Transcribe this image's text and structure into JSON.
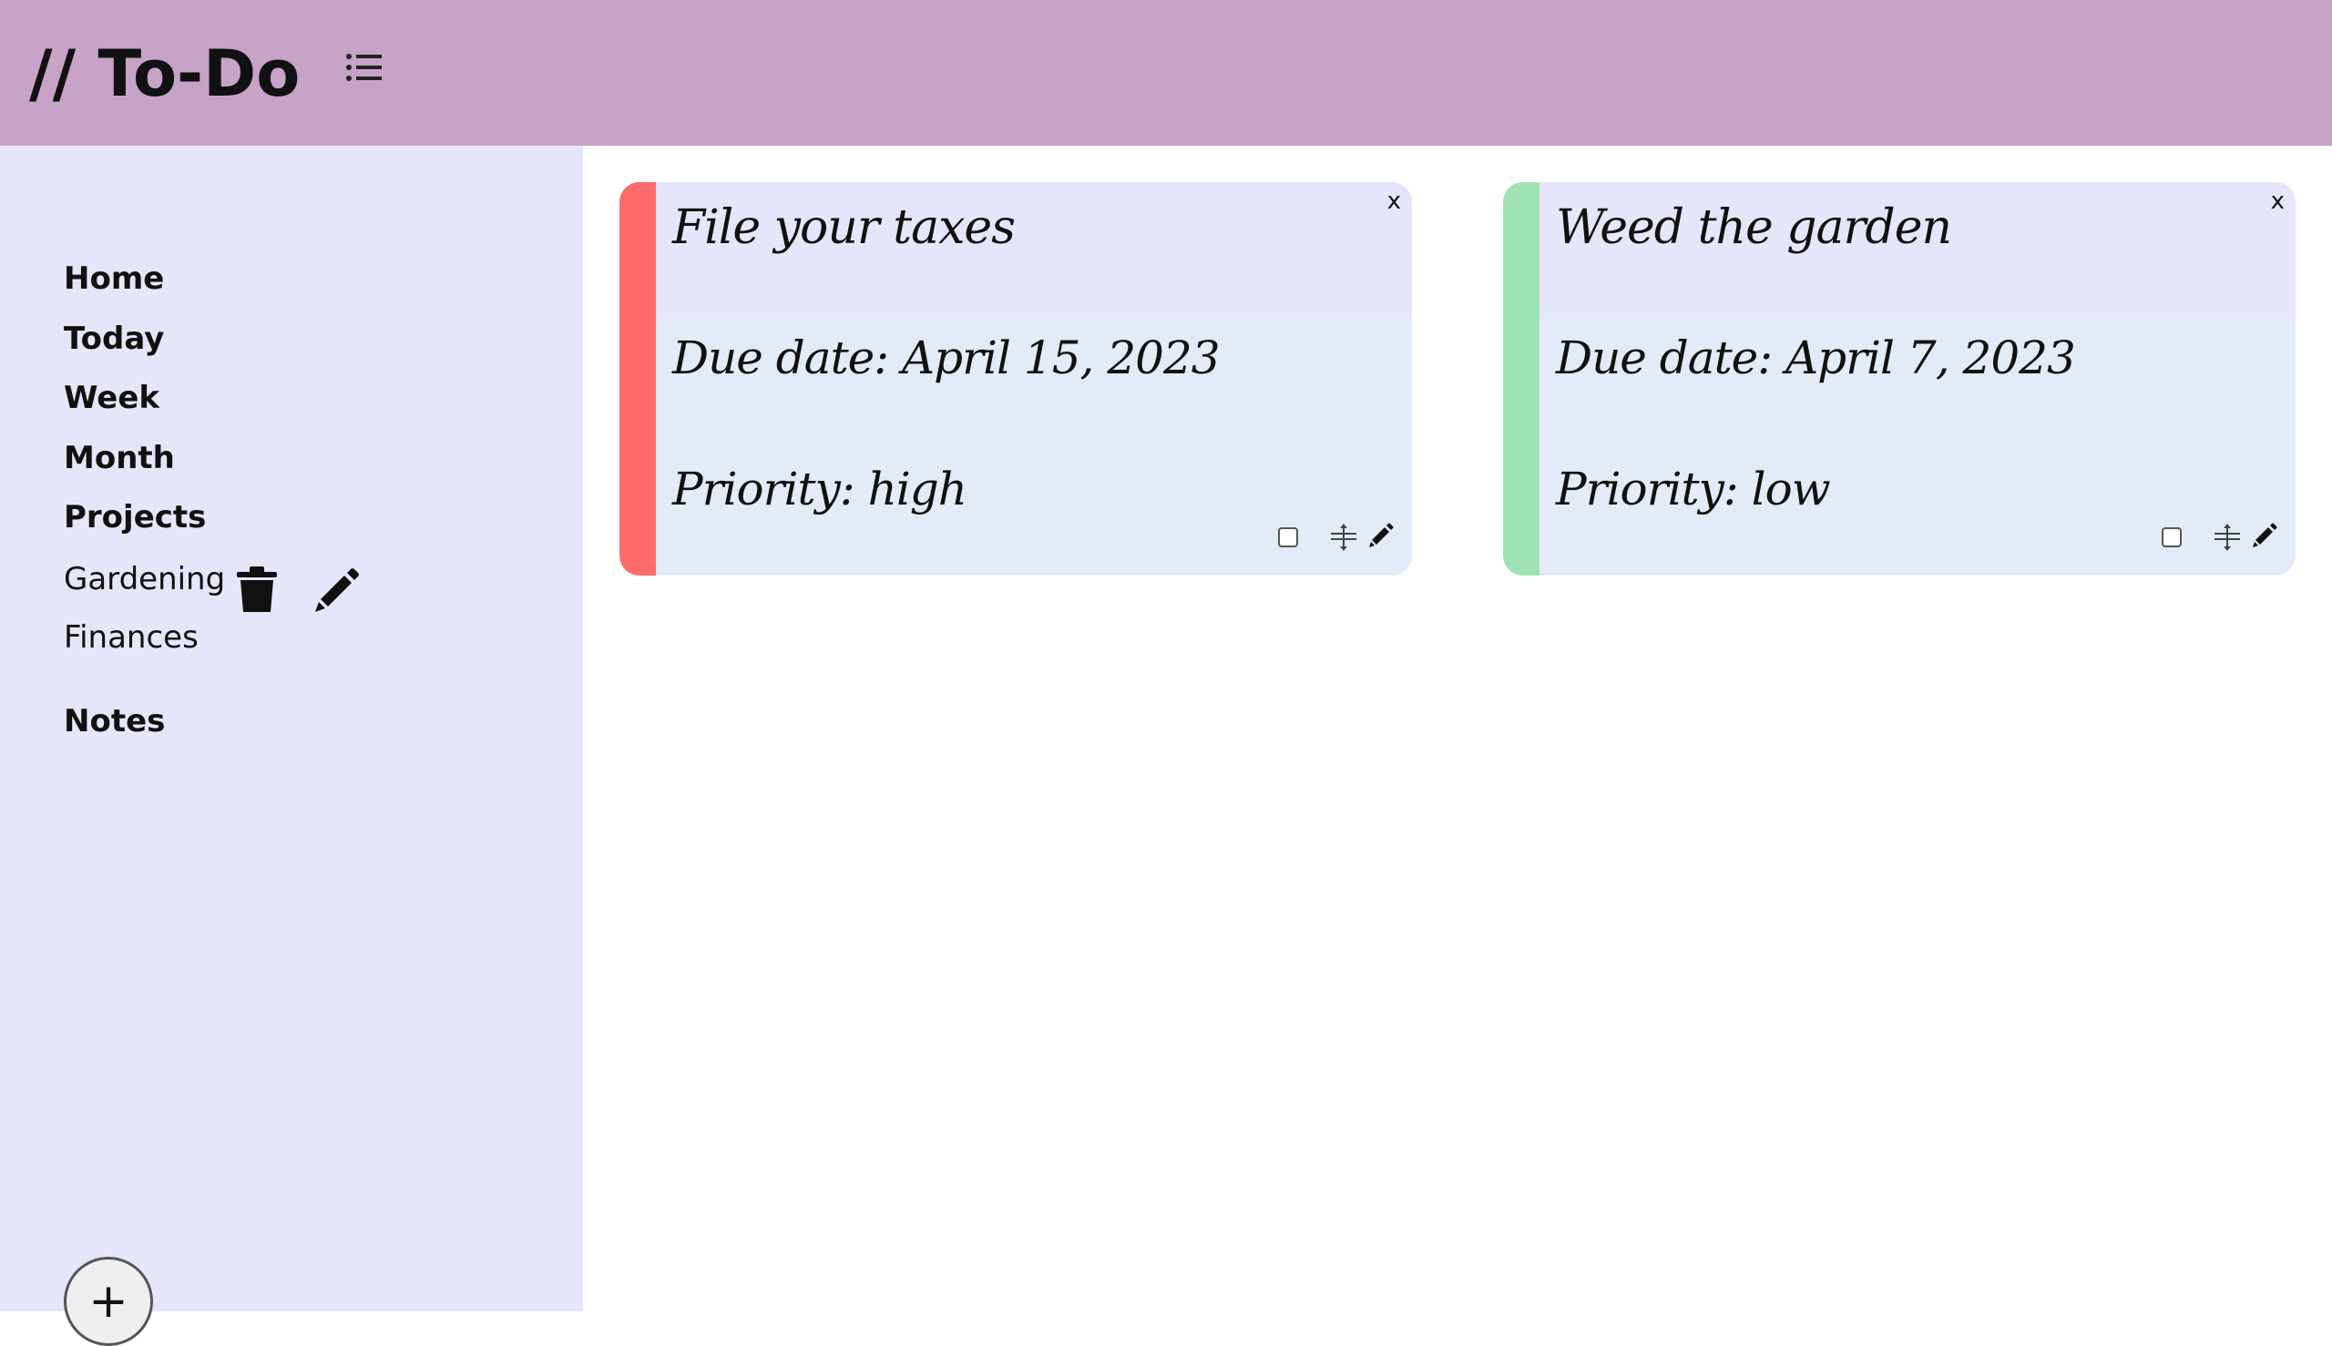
{
  "header": {
    "title": "// To-Do",
    "icon": "list-icon",
    "background_color": "#c8a3c8"
  },
  "sidebar": {
    "background_color": "#e6e6fa",
    "nav": [
      {
        "label": "Home"
      },
      {
        "label": "Today"
      },
      {
        "label": "Week"
      },
      {
        "label": "Month"
      },
      {
        "label": "Projects"
      }
    ],
    "projects": [
      {
        "label": "Gardening",
        "icons": [
          "trash-icon",
          "pencil-icon"
        ]
      },
      {
        "label": "Finances"
      }
    ],
    "notes_label": "Notes",
    "add_button_label": "+"
  },
  "tasks": [
    {
      "title": "File your taxes",
      "due": "Due date: April 15, 2023",
      "priority": "Priority: high",
      "close_label": "x",
      "priority_color": "#ff6b6b"
    },
    {
      "title": "Weed the garden",
      "due": "Due date: April 7, 2023",
      "priority": "Priority: low",
      "close_label": "x",
      "priority_color": "#9fe2b4"
    }
  ]
}
